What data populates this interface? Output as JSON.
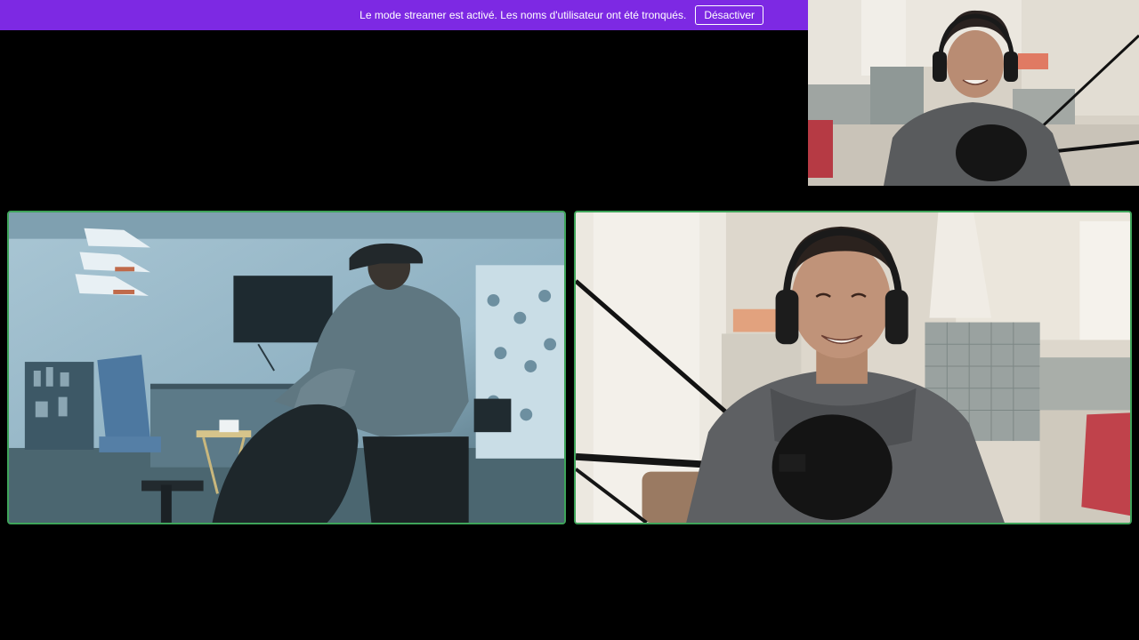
{
  "banner": {
    "message": "Le mode streamer est activé. Les noms d'utilisateur ont été tronqués.",
    "button_label": "Désactiver",
    "background_color": "#7d29e3"
  },
  "self_view": {
    "scene": "man with headphones and microphone in kitchen"
  },
  "tiles": [
    {
      "scene": "person in hoodie and cap in blue-lit bedroom",
      "speaking_border_color": "#3fa45a"
    },
    {
      "scene": "smiling man with headphones and microphone in kitchen",
      "speaking_border_color": "#3fa45a"
    }
  ]
}
